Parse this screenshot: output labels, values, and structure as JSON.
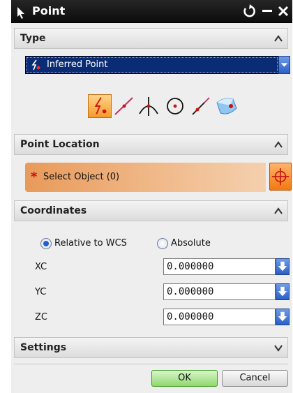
{
  "window": {
    "title": "Point",
    "icon": "point-dialog-icon",
    "controls": [
      "reset-icon",
      "minimize-icon",
      "close-icon"
    ]
  },
  "type_section": {
    "title": "Type",
    "selected": "Inferred Point",
    "point_icons": [
      "inferred-point-icon",
      "line-point-icon",
      "intersection-point-icon",
      "arc-center-icon",
      "endpoint-icon",
      "surface-point-icon"
    ]
  },
  "point_location": {
    "title": "Point Location",
    "select_object": "Select Object (0)",
    "required_marker": "*"
  },
  "coordinates": {
    "title": "Coordinates",
    "relative_label": "Relative to WCS",
    "absolute_label": "Absolute",
    "selected_mode": "Relative to WCS",
    "fields": [
      {
        "label": "XC",
        "value": "0.000000"
      },
      {
        "label": "YC",
        "value": "0.000000"
      },
      {
        "label": "ZC",
        "value": "0.000000"
      }
    ]
  },
  "settings": {
    "title": "Settings"
  },
  "buttons": {
    "ok": "OK",
    "cancel": "Cancel"
  },
  "colors": {
    "titlebar": "#1a1a1a",
    "select_highlight": "#0a2c75",
    "accent_orange": "#f07a10",
    "ok_green": "#8fd76d"
  }
}
